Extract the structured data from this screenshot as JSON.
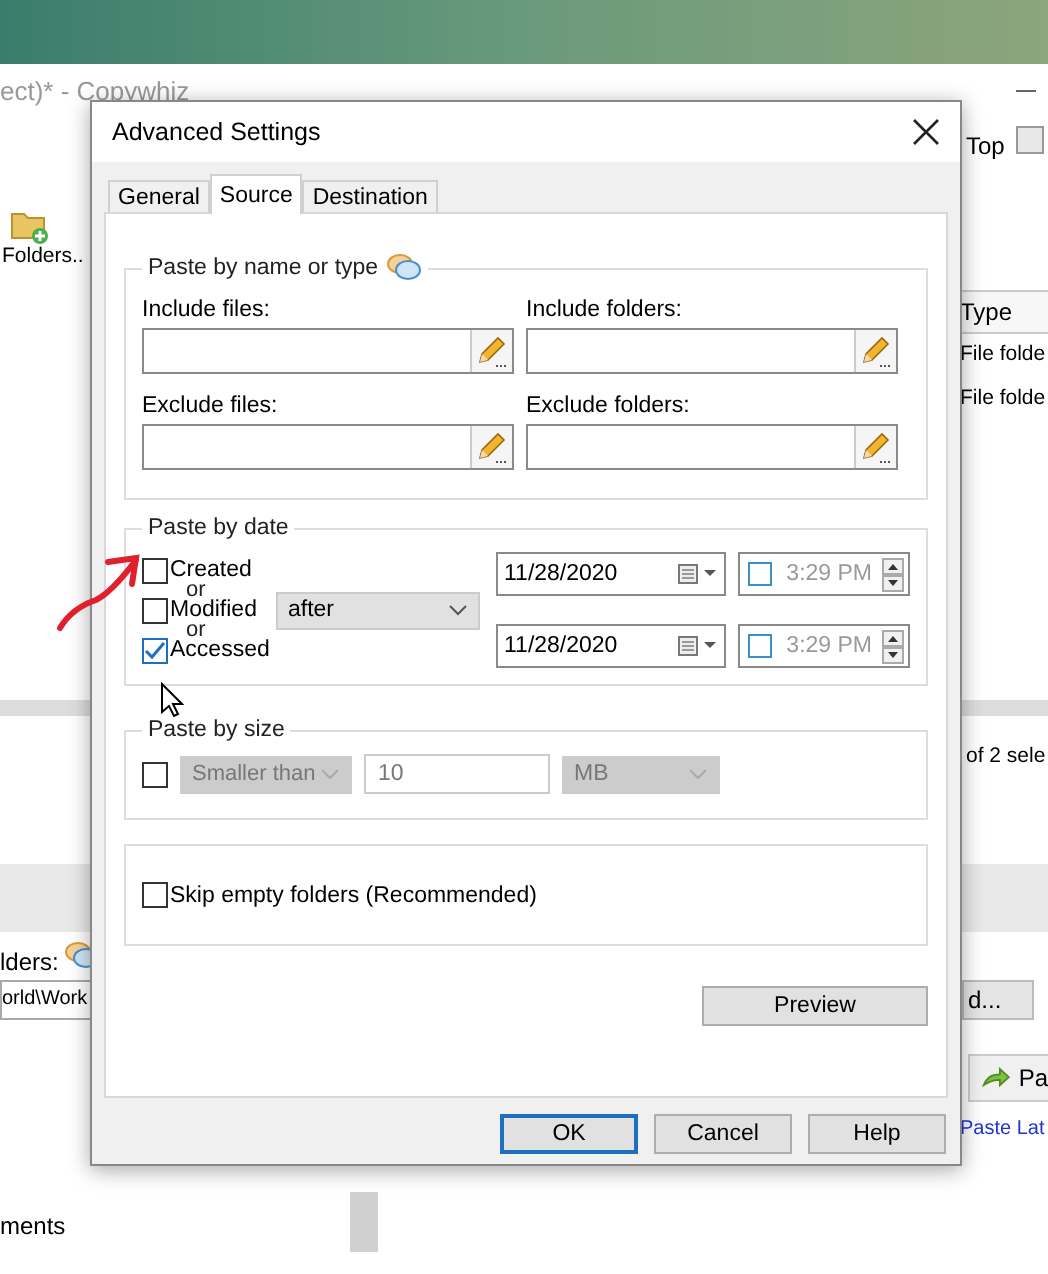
{
  "app_window": {
    "title": "ect)* - Copywhiz",
    "toolbar_right": "Top",
    "toolbar_button": "Folders..",
    "column": "Type",
    "rows": [
      "File folde",
      "File folde"
    ],
    "selection_status": "of 2 sele",
    "folders_label": "lders:",
    "path_value": "orld\\Work",
    "browse_button": "d...",
    "paste_button": "Pa",
    "paste_later_link": "Paste Lat",
    "bottom_item": "ments"
  },
  "dialog": {
    "title": "Advanced Settings",
    "tabs": [
      {
        "label": "General",
        "selected": false
      },
      {
        "label": "Source",
        "selected": true
      },
      {
        "label": "Destination",
        "selected": false
      }
    ],
    "name_group": {
      "title": "Paste by name or type",
      "fields": [
        {
          "label": "Include files:"
        },
        {
          "label": "Include folders:"
        },
        {
          "label": "Exclude files:"
        },
        {
          "label": "Exclude folders:"
        }
      ]
    },
    "date_group": {
      "title": "Paste by date",
      "options": [
        {
          "label": "Created",
          "checked": false
        },
        {
          "label": "Modified",
          "checked": false
        },
        {
          "label": "Accessed",
          "checked": true
        }
      ],
      "connectors": [
        "or",
        "or"
      ],
      "comparison": "after",
      "dates": [
        {
          "date": "11/28/2020",
          "time": "3:29 PM",
          "time_checked": false
        },
        {
          "date": "11/28/2020",
          "time": "3:29 PM",
          "time_checked": false
        }
      ]
    },
    "size_group": {
      "title": "Paste by size",
      "checked": false,
      "disabled": true,
      "comparison": "Smaller than",
      "amount": "10",
      "unit": "MB"
    },
    "skip_empty": {
      "label": "Skip empty folders (Recommended)",
      "checked": false
    },
    "preview_button": "Preview",
    "buttons": [
      {
        "label": "OK",
        "default": true
      },
      {
        "label": "Cancel",
        "default": false
      },
      {
        "label": "Help",
        "default": false
      }
    ]
  }
}
